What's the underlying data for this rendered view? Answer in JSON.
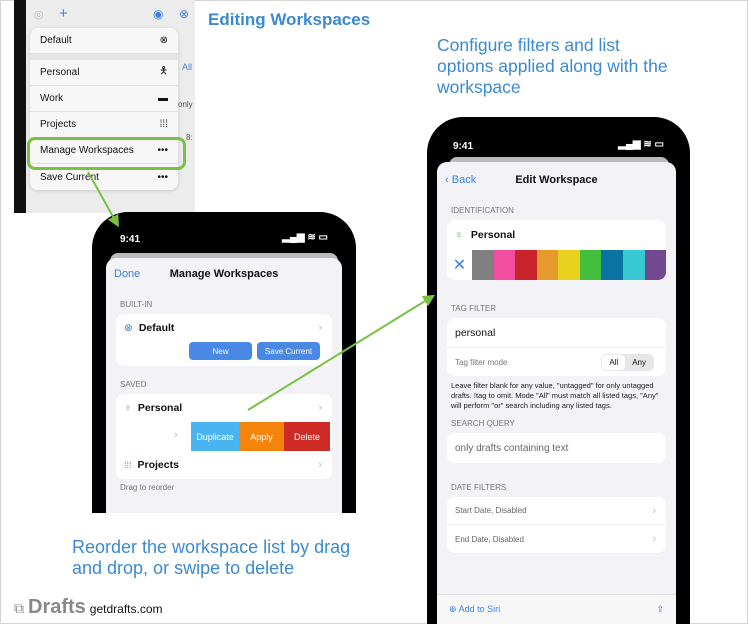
{
  "title": "Editing Workspaces",
  "caption_right": "Configure filters and list options applied along with the workspace",
  "caption_bottom": "Reorder the workspace list by drag and drop, or swipe to delete",
  "brand": {
    "logo": "Drafts",
    "url": "getdrafts.com"
  },
  "accent": "#3b8ad0",
  "highlight": "#7ac143",
  "menu": {
    "bg_hints": [
      "All",
      "only",
      "8:"
    ],
    "items": [
      {
        "label": "Default",
        "icon": "xmark-circle-icon"
      },
      {
        "label": "Personal",
        "icon": "person-icon"
      },
      {
        "label": "Work",
        "icon": "briefcase-icon"
      },
      {
        "label": "Projects",
        "icon": "grid-icon"
      },
      {
        "label": "Manage Workspaces",
        "icon": "ellipsis-icon"
      },
      {
        "label": "Save Current",
        "icon": "ellipsis-icon"
      }
    ]
  },
  "manage": {
    "time": "9:41",
    "done": "Done",
    "title": "Manage Workspaces",
    "builtin_header": "BUILT-IN",
    "default": "Default",
    "new": "New",
    "save_current": "Save Current",
    "saved_header": "SAVED",
    "personal": "Personal",
    "duplicate": "Duplicate",
    "apply": "Apply",
    "delete": "Delete",
    "projects": "Projects",
    "footer": "Drag to reorder",
    "colors": {
      "duplicate": "#4ab4f0",
      "apply": "#f5840c",
      "delete": "#cc2b26"
    }
  },
  "edit": {
    "time": "9:41",
    "back": "Back",
    "title": "Edit Workspace",
    "identification": "IDENTIFICATION",
    "name": "Personal",
    "swatches": [
      "#808080",
      "#f14ea0",
      "#c9242b",
      "#e79a2c",
      "#e8d21f",
      "#43be3c",
      "#0a73a2",
      "#38c8d2",
      "#72498f"
    ],
    "tag_header": "TAG FILTER",
    "tag_value": "personal",
    "tag_mode_label": "Tag filter mode",
    "mode_all": "All",
    "mode_any": "Any",
    "mode_selected": "All",
    "tag_help": "Leave filter blank for any value, \"untagged\" for only untagged drafts. !tag to omit. Mode \"All\" must match all listed tags, \"Any\" will perform \"or\" search including any listed tags.",
    "search_header": "SEARCH QUERY",
    "search_placeholder": "only drafts containing text",
    "date_header": "DATE FILTERS",
    "start_date": "Start Date, Disabled",
    "end_date": "End Date, Disabled",
    "add_siri": "Add to Siri"
  }
}
